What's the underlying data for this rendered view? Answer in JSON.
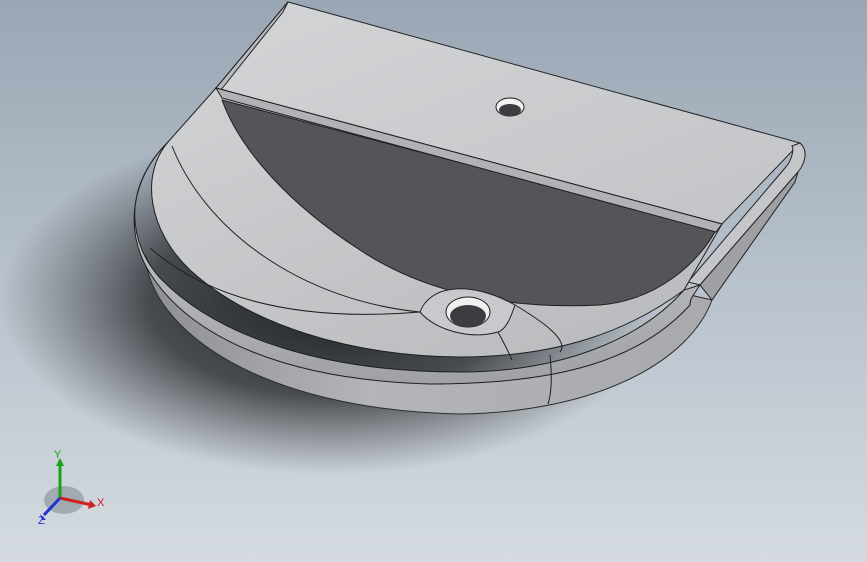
{
  "viewport": {
    "view": "isometric",
    "model": "wash-basin",
    "colors": {
      "background_top": "#9aa6b4",
      "background_bottom": "#d4dae0",
      "model_light": "#c6c8cb",
      "model_mid": "#a6a8ab",
      "model_dark": "#555659",
      "edge": "#1f1f1f"
    }
  },
  "triad": {
    "x_label": "X",
    "y_label": "Y",
    "z_label": "Z",
    "x_color": "#d21f1f",
    "y_color": "#18a318",
    "z_color": "#1f33d6"
  }
}
